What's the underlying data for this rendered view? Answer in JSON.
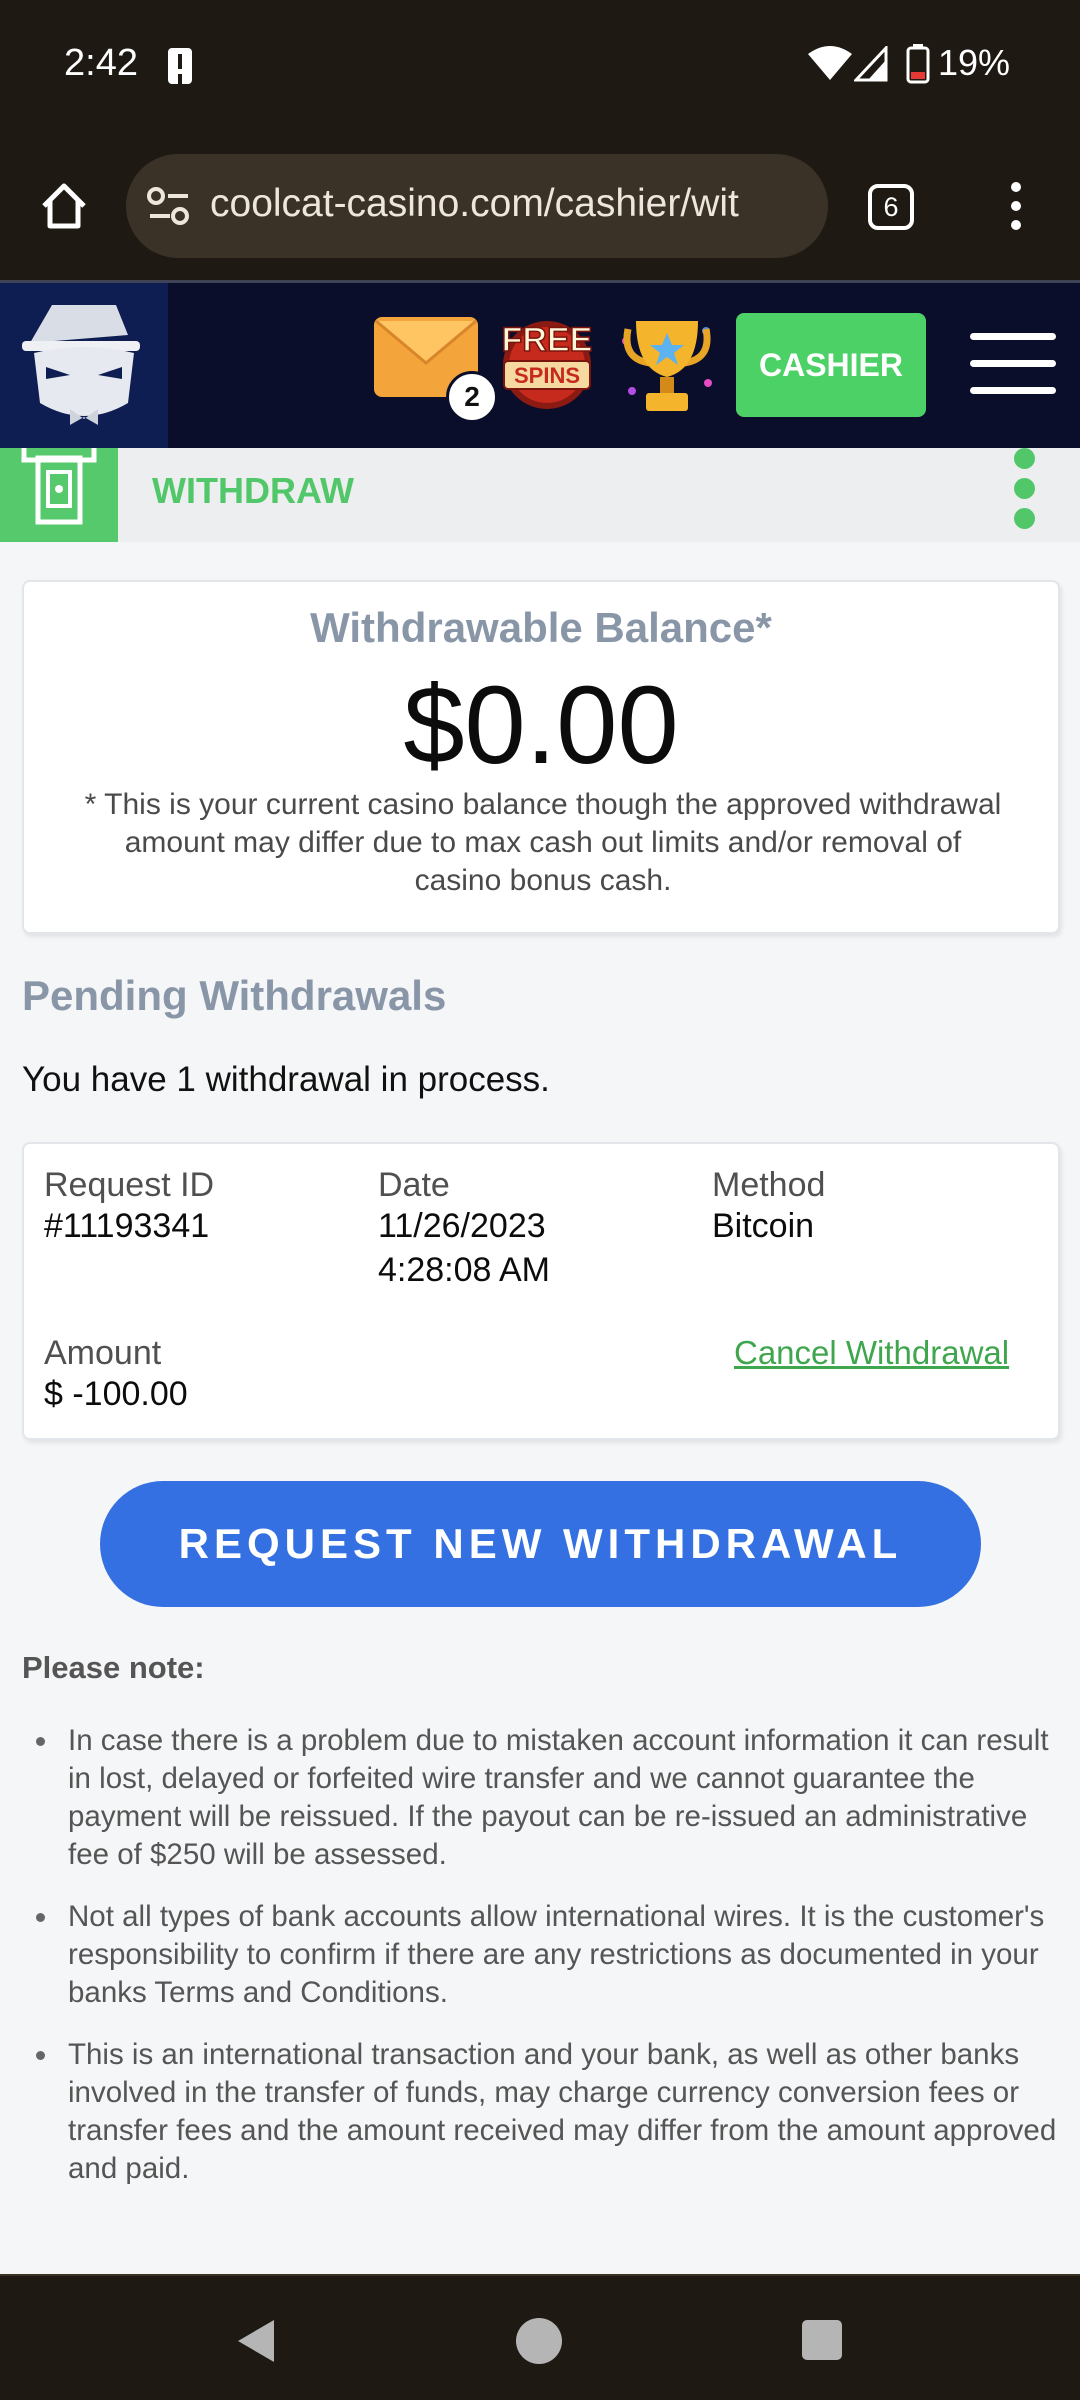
{
  "status_bar": {
    "time": "2:42",
    "battery": "19%",
    "icons": [
      "alert-icon",
      "wifi-icon",
      "signal-icon",
      "battery-icon"
    ]
  },
  "browser": {
    "url": "coolcat-casino.com/cashier/wit",
    "tab_count": "6"
  },
  "header": {
    "mail_badge": "2",
    "free_spins_line1": "FREE",
    "free_spins_line2": "SPINS",
    "cashier_label": "CASHIER",
    "colors": {
      "cashier": "#4bd166",
      "header_bg": "#0a0e2a",
      "logo_bg": "#0e1d52"
    }
  },
  "withdraw_bar": {
    "title": "WITHDRAW",
    "accent": "#52c76a"
  },
  "balance": {
    "title": "Withdrawable Balance*",
    "amount": "$0.00",
    "note": "* This is your current casino balance though the approved withdrawal amount may differ due to max cash out limits and/or removal of casino bonus cash."
  },
  "pending": {
    "title": "Pending Withdrawals",
    "count_text": "You have 1 withdrawal in process.",
    "labels": {
      "request_id": "Request ID",
      "date": "Date",
      "method": "Method",
      "amount": "Amount"
    },
    "item": {
      "request_id": "#11193341",
      "date": "11/26/2023",
      "time": "4:28:08 AM",
      "method": "Bitcoin",
      "amount": "$ -100.00",
      "cancel_label": "Cancel Withdrawal"
    }
  },
  "request_button": {
    "label": "REQUEST NEW WITHDRAWAL",
    "color": "#3470e2"
  },
  "notes": {
    "heading": "Please note:",
    "items": [
      "In case there is a problem due to mistaken account information it can result in lost, delayed or forfeited wire transfer and we cannot guarantee the payment will be reissued. If the payout can be re-issued an administrative fee of $250 will be assessed.",
      "Not all types of bank accounts allow international wires. It is the customer's responsibility to confirm if there are any restrictions as documented in your banks Terms and Conditions.",
      "This is an international transaction and your bank, as well as other banks involved in the transfer of funds, may charge currency conversion fees or transfer fees and the amount received may differ from the amount approved and paid."
    ]
  }
}
